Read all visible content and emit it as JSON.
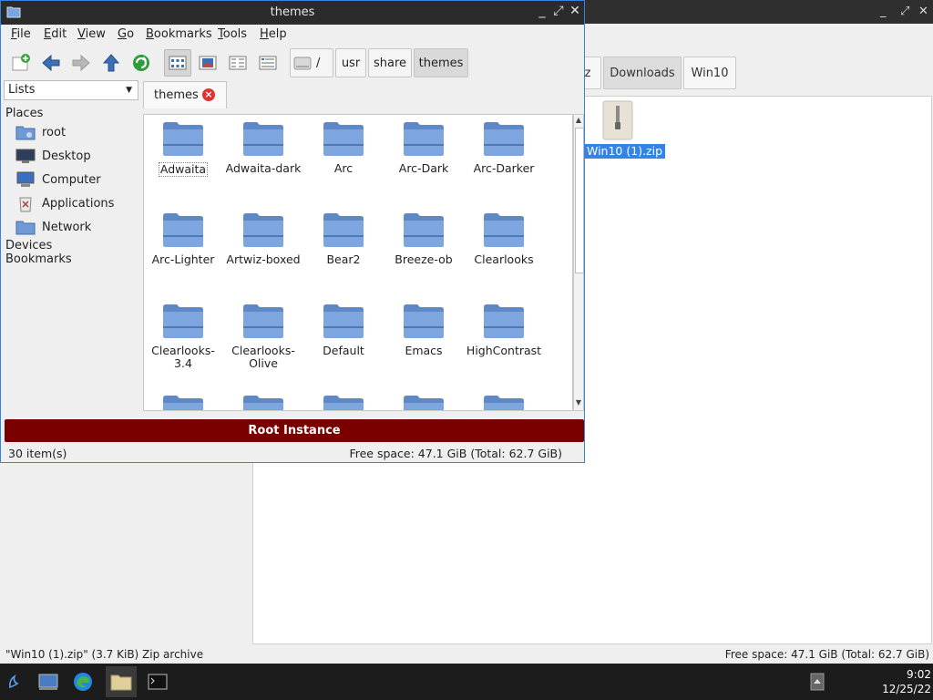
{
  "background_window": {
    "path_buttons": [
      "z",
      "Downloads",
      "Win10"
    ],
    "file": {
      "label": "Win10 (1).zip"
    },
    "status_left": "\"Win10 (1).zip\" (3.7 KiB) Zip archive",
    "status_right": "Free space: 47.1 GiB (Total: 62.7 GiB)"
  },
  "window": {
    "title": "themes",
    "controls": {
      "minimize": "_",
      "maximize": "⤢",
      "close": "✕"
    }
  },
  "menu": {
    "items": [
      {
        "first": "F",
        "rest": "ile"
      },
      {
        "first": "E",
        "rest": "dit"
      },
      {
        "first": "V",
        "rest": "iew"
      },
      {
        "first": "G",
        "rest": "o"
      },
      {
        "first": "B",
        "rest": "ookmarks"
      },
      {
        "first": "T",
        "rest": "ools"
      },
      {
        "first": "H",
        "rest": "elp"
      }
    ]
  },
  "path": {
    "buttons": [
      "/",
      "usr",
      "share",
      "themes"
    ]
  },
  "side_pane": {
    "mode": "Lists",
    "places_heading": "Places",
    "places": [
      "root",
      "Desktop",
      "Computer",
      "Applications",
      "Network"
    ],
    "devices_heading": "Devices",
    "bookmarks_heading": "Bookmarks"
  },
  "tab": {
    "label": "themes",
    "close": "×"
  },
  "items": [
    "Adwaita",
    "Adwaita-dark",
    "Arc",
    "Arc-Dark",
    "Arc-Darker",
    "Arc-Lighter",
    "Artwiz-boxed",
    "Bear2",
    "Breeze-ob",
    "Clearlooks",
    "Clearlooks-3.4",
    "Clearlooks-Olive",
    "Default",
    "Emacs",
    "HighContrast",
    "",
    "",
    "",
    "",
    ""
  ],
  "root_banner": "Root Instance",
  "status": {
    "item_count": "30 item(s)",
    "free_space": "Free space: 47.1 GiB (Total: 62.7 GiB)"
  },
  "taskbar": {
    "time": "9:02",
    "date": "12/25/22"
  },
  "colors": {
    "accent": "#3584e4",
    "root_banner": "#7a0000",
    "folder": "#6f9ad6"
  }
}
